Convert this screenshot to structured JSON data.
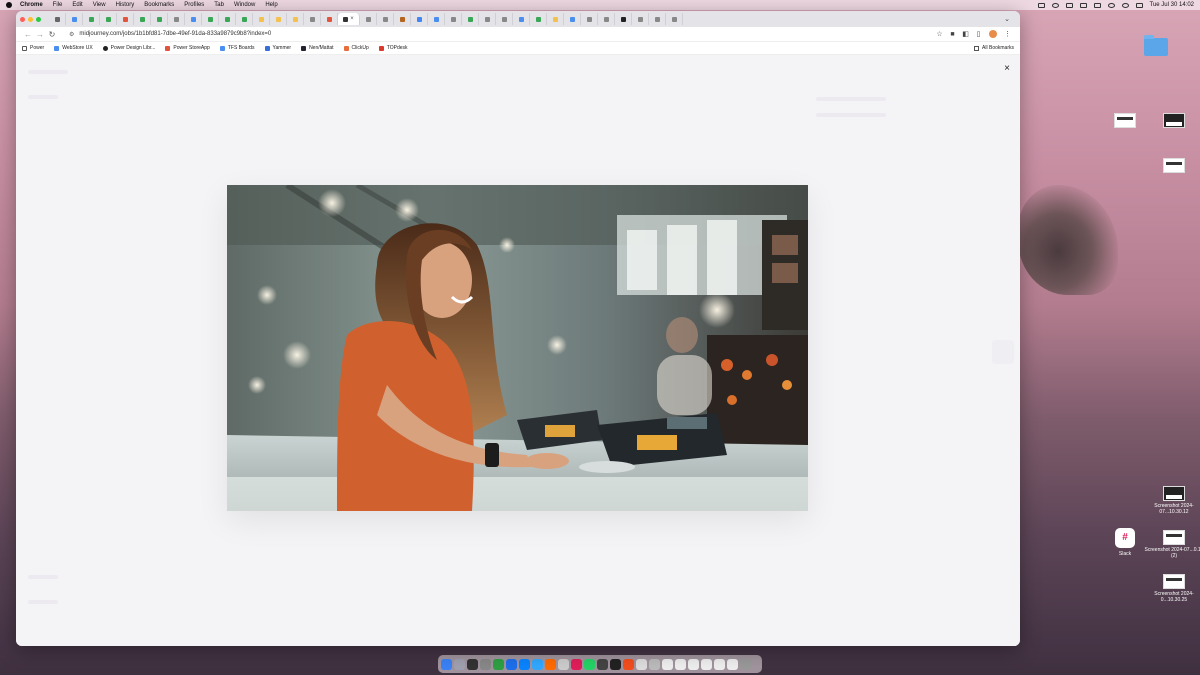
{
  "menubar": {
    "app": "Chrome",
    "items": [
      "File",
      "Edit",
      "View",
      "History",
      "Bookmarks",
      "Profiles",
      "Tab",
      "Window",
      "Help"
    ],
    "datetime": "Tue Jul 30  14:02"
  },
  "browser": {
    "url": "midjourney.com/jobs/1b1bfd81-7dbe-49ef-91da-833a9879c9b8?index=0",
    "bookmarks": [
      "Power",
      "WebStore UX",
      "Power Design Libr...",
      "Power StoreApp",
      "TFS Boards",
      "Yammer",
      "Nen/Mattat",
      "ClickUp",
      "TOPdesk"
    ],
    "all_bookmarks": "All Bookmarks",
    "close_glyph": "×"
  },
  "desktop": {
    "items": [
      {
        "name": "folder-icon",
        "label": ""
      },
      {
        "label": "Screenshot 2024-07...10.30.12"
      },
      {
        "label": "Screenshot 2024-07...0.12 (2)"
      },
      {
        "label": "Screenshot 2024-0...10.30.25"
      },
      {
        "label": "Slack"
      }
    ]
  },
  "colors": {
    "accent_tab_red": "#e2543e",
    "accent_green": "#3aa757",
    "accent_blue": "#4a8ef0",
    "shirt_orange": "#d0612f"
  }
}
